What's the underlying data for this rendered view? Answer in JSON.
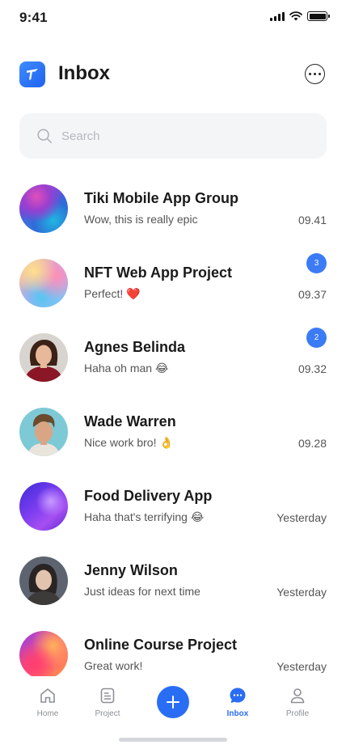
{
  "status_bar": {
    "time": "9:41"
  },
  "header": {
    "title": "Inbox",
    "logo_icon": "app-logo-icon",
    "menu_icon": "more-horizontal-icon"
  },
  "search": {
    "placeholder": "Search",
    "value": "",
    "icon": "search-icon"
  },
  "chats": [
    {
      "name": "Tiki Mobile App Group",
      "message": "Wow, this is really epic",
      "time": "09.41",
      "badge": ""
    },
    {
      "name": "NFT Web App Project",
      "message": "Perfect! ❤️",
      "time": "09.37",
      "badge": "3"
    },
    {
      "name": "Agnes Belinda",
      "message": "Haha oh man 😂",
      "time": "09.32",
      "badge": "2"
    },
    {
      "name": "Wade Warren",
      "message": "Nice work bro! 👌",
      "time": "09.28",
      "badge": ""
    },
    {
      "name": "Food Delivery App",
      "message": "Haha that's terrifying 😂",
      "time": "Yesterday",
      "badge": ""
    },
    {
      "name": "Jenny Wilson",
      "message": "Just ideas for next time",
      "time": "Yesterday",
      "badge": ""
    },
    {
      "name": "Online Course Project",
      "message": "Great work!",
      "time": "Yesterday",
      "badge": ""
    }
  ],
  "tab_bar": {
    "tabs": [
      {
        "label": "Home",
        "icon": "home-icon",
        "active": false
      },
      {
        "label": "Project",
        "icon": "document-icon",
        "active": false
      },
      {
        "label": "Inbox",
        "icon": "chat-bubble-icon",
        "active": true
      },
      {
        "label": "Profile",
        "icon": "user-icon",
        "active": false
      }
    ],
    "add_icon": "plus-icon"
  },
  "colors": {
    "accent": "#2A6DF5",
    "badge": "#3B7BF6",
    "search_bg": "#F4F5F7"
  }
}
